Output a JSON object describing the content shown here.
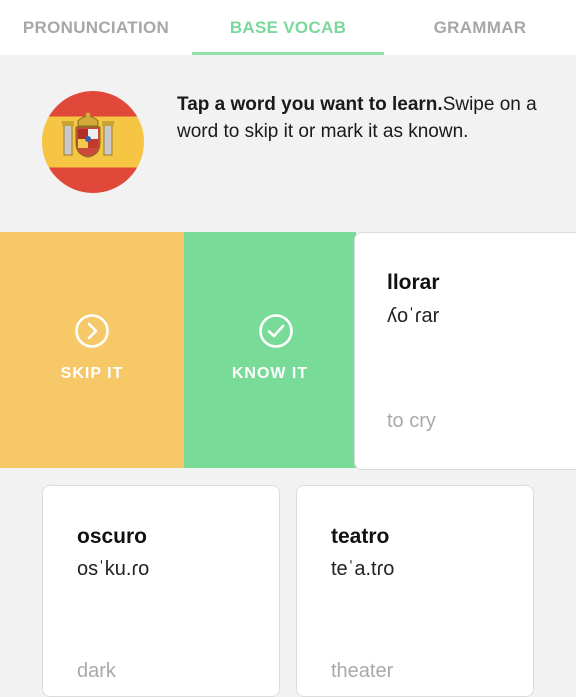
{
  "tabs": [
    {
      "label": "PRONUNCIATION"
    },
    {
      "label": "BASE VOCAB"
    },
    {
      "label": "GRAMMAR"
    }
  ],
  "active_tab": "BASE VOCAB",
  "colors": {
    "accent_green": "#7ad99a",
    "skip_yellow": "#f6c867",
    "know_green": "#78dc98"
  },
  "intro": {
    "bold": "Tap a word you want to learn.",
    "rest": "Swipe on a word to skip it or mark it as known."
  },
  "swipe_actions": {
    "skip": {
      "label": "SKIP IT",
      "icon": "chevron-right-circle-icon"
    },
    "know": {
      "label": "KNOW IT",
      "icon": "check-circle-icon"
    }
  },
  "cards": [
    {
      "word": "llorar",
      "ipa": "ʎoˈɾar",
      "meaning": "to cry"
    },
    {
      "word": "oscuro",
      "ipa": "osˈku.ɾo",
      "meaning": "dark"
    },
    {
      "word": "teatro",
      "ipa": "teˈa.tɾo",
      "meaning": "theater"
    }
  ]
}
